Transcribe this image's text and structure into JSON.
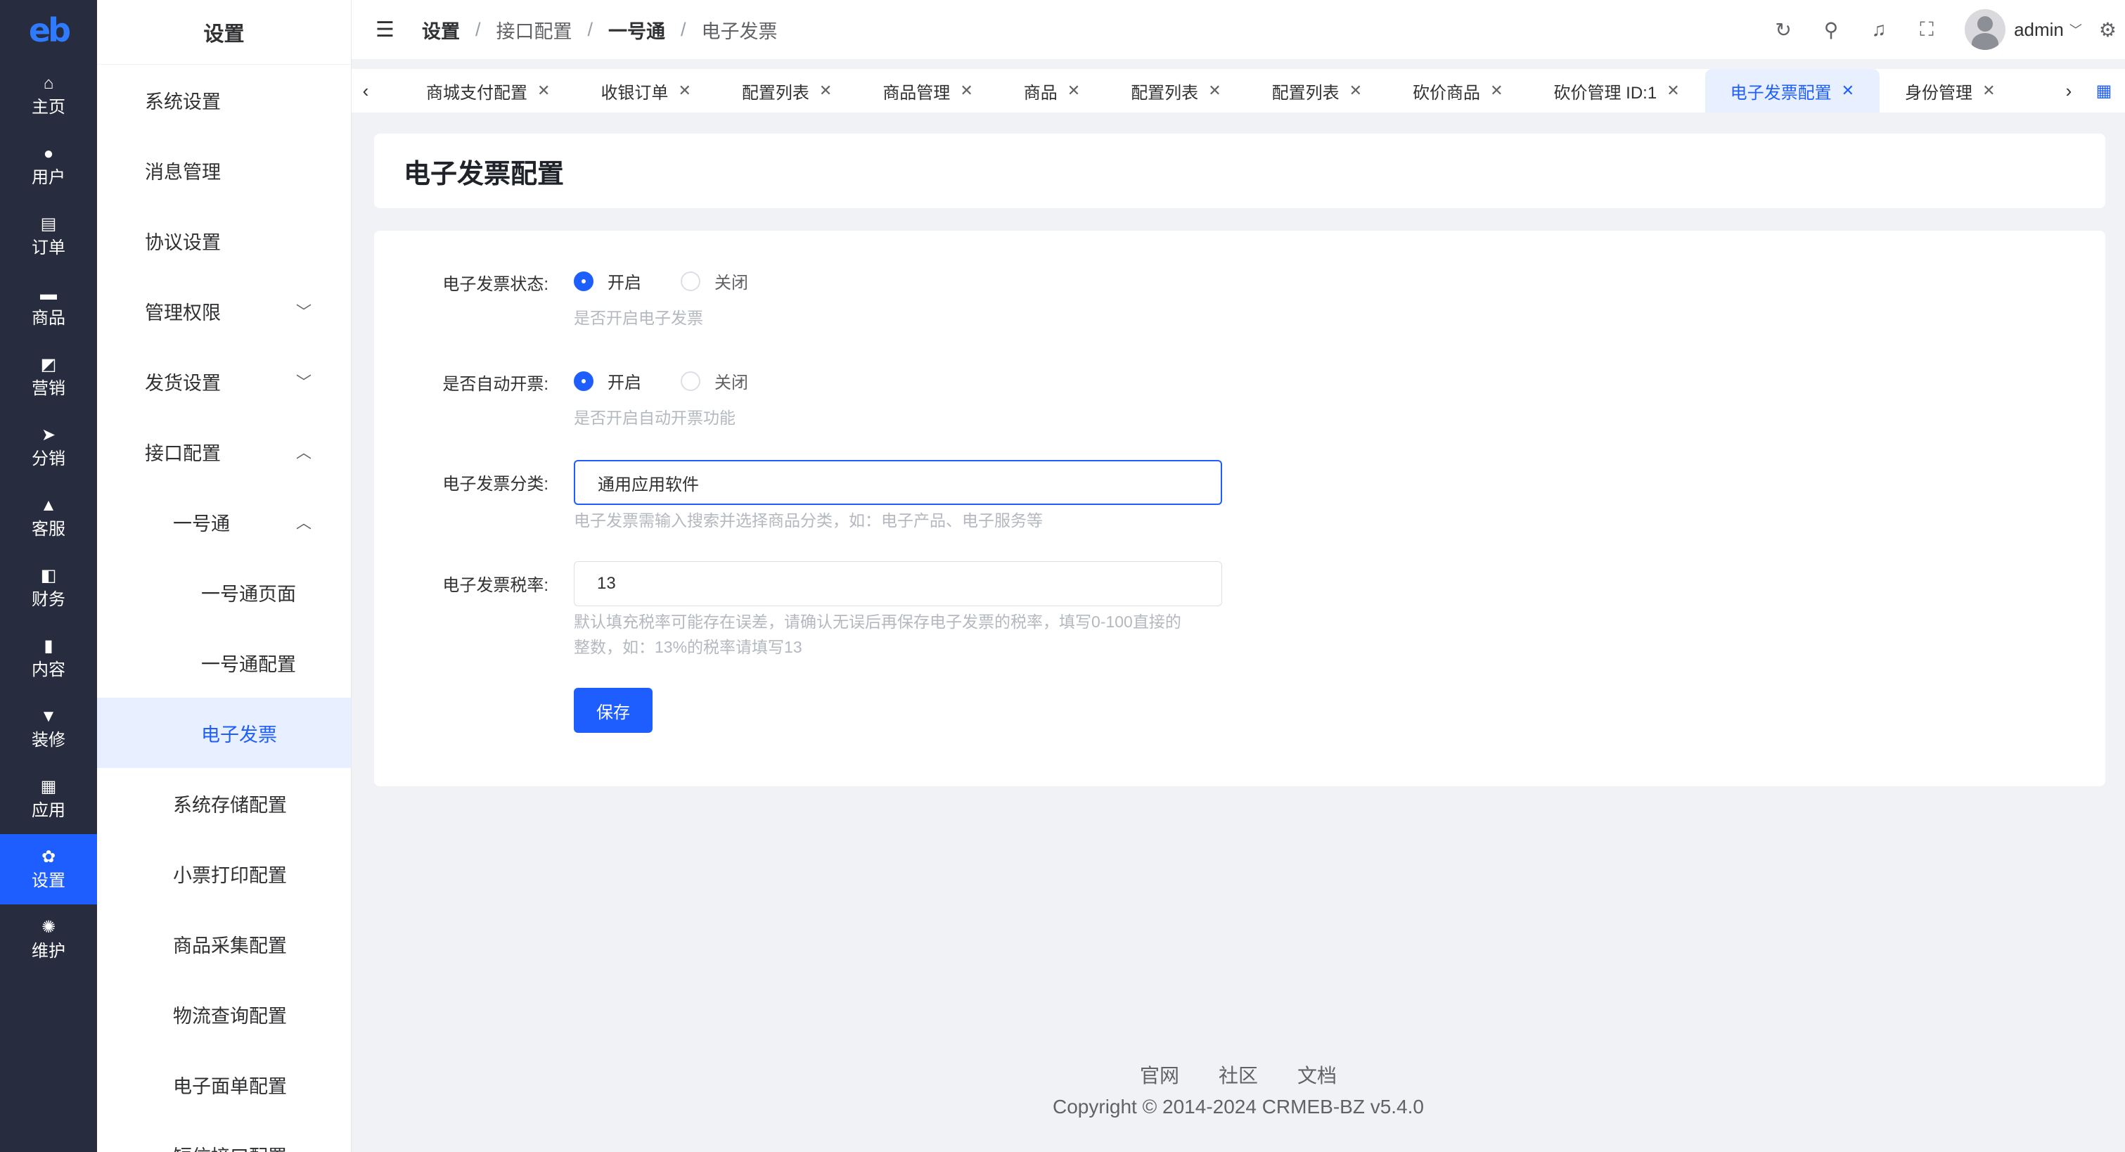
{
  "logo": "eb",
  "rail": [
    {
      "label": "主页",
      "icon": "home-icon",
      "glyph": "⌂"
    },
    {
      "label": "用户",
      "icon": "user-icon",
      "glyph": "●"
    },
    {
      "label": "订单",
      "icon": "order-icon",
      "glyph": "▤"
    },
    {
      "label": "商品",
      "icon": "goods-icon",
      "glyph": "▬"
    },
    {
      "label": "营销",
      "icon": "marketing-icon",
      "glyph": "◩"
    },
    {
      "label": "分销",
      "icon": "send-icon",
      "glyph": "➤"
    },
    {
      "label": "客服",
      "icon": "bell-icon",
      "glyph": "▲"
    },
    {
      "label": "财务",
      "icon": "wallet-icon",
      "glyph": "◧"
    },
    {
      "label": "内容",
      "icon": "content-icon",
      "glyph": "▮"
    },
    {
      "label": "装修",
      "icon": "decorate-icon",
      "glyph": "▼"
    },
    {
      "label": "应用",
      "icon": "apps-icon",
      "glyph": "▦"
    },
    {
      "label": "设置",
      "icon": "gear-icon",
      "glyph": "✿"
    },
    {
      "label": "维护",
      "icon": "maintain-icon",
      "glyph": "✺"
    }
  ],
  "sidebar": {
    "title": "设置",
    "items": [
      {
        "label": "系统设置",
        "level": 1,
        "chevron": ""
      },
      {
        "label": "消息管理",
        "level": 1,
        "chevron": ""
      },
      {
        "label": "协议设置",
        "level": 1,
        "chevron": ""
      },
      {
        "label": "管理权限",
        "level": 1,
        "chevron": "﹀"
      },
      {
        "label": "发货设置",
        "level": 1,
        "chevron": "﹀"
      },
      {
        "label": "接口配置",
        "level": 1,
        "chevron": "︿"
      },
      {
        "label": "一号通",
        "level": 2,
        "chevron": "︿"
      },
      {
        "label": "一号通页面",
        "level": 3,
        "chevron": ""
      },
      {
        "label": "一号通配置",
        "level": 3,
        "chevron": ""
      },
      {
        "label": "电子发票",
        "level": 3,
        "chevron": "",
        "active": true
      },
      {
        "label": "系统存储配置",
        "level": 2,
        "chevron": ""
      },
      {
        "label": "小票打印配置",
        "level": 2,
        "chevron": ""
      },
      {
        "label": "商品采集配置",
        "level": 2,
        "chevron": ""
      },
      {
        "label": "物流查询配置",
        "level": 2,
        "chevron": ""
      },
      {
        "label": "电子面单配置",
        "level": 2,
        "chevron": ""
      },
      {
        "label": "短信接口配置",
        "level": 2,
        "chevron": ""
      }
    ]
  },
  "header": {
    "breadcrumb": [
      "设置",
      "接口配置",
      "一号通",
      "电子发票"
    ],
    "username": "admin"
  },
  "tabs": [
    {
      "label": "商城支付配置",
      "active": false
    },
    {
      "label": "收银订单",
      "active": false
    },
    {
      "label": "配置列表",
      "active": false
    },
    {
      "label": "商品管理",
      "active": false
    },
    {
      "label": "商品",
      "active": false
    },
    {
      "label": "配置列表",
      "active": false
    },
    {
      "label": "配置列表",
      "active": false
    },
    {
      "label": "砍价商品",
      "active": false
    },
    {
      "label": "砍价管理 ID:1",
      "active": false
    },
    {
      "label": "电子发票配置",
      "active": true
    },
    {
      "label": "身份管理",
      "active": false
    }
  ],
  "page": {
    "title": "电子发票配置"
  },
  "form": {
    "invoice_status": {
      "label": "电子发票状态:",
      "on": "开启",
      "off": "关闭",
      "selected": "on",
      "hint": "是否开启电子发票"
    },
    "auto_issue": {
      "label": "是否自动开票:",
      "on": "开启",
      "off": "关闭",
      "selected": "on",
      "hint": "是否开启自动开票功能"
    },
    "category": {
      "label": "电子发票分类:",
      "value": "通用应用软件",
      "hint": "电子发票需输入搜索并选择商品分类，如：电子产品、电子服务等"
    },
    "tax_rate": {
      "label": "电子发票税率:",
      "value": "13",
      "hint_line1": "默认填充税率可能存在误差，请确认无误后再保存电子发票的税率，填写0-100直接的",
      "hint_line2": "整数，如：13%的税率请填写13"
    },
    "save_label": "保存"
  },
  "footer": {
    "links": [
      "官网",
      "社区",
      "文档"
    ],
    "copyright": "Copyright © 2014-2024 CRMEB-BZ v5.4.0"
  },
  "colors": {
    "accent": "#1e5eff",
    "rail_bg": "#282c3f",
    "page_bg": "#f0f2f5"
  }
}
